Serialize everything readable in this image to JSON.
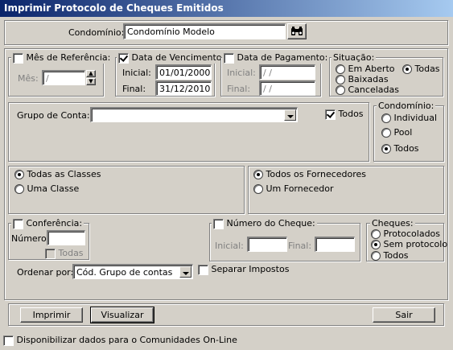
{
  "window": {
    "title": "Imprimir Protocolo de Cheques Emitidos"
  },
  "condominio": {
    "label": "Condomínio:",
    "value": "Condomínio Modelo"
  },
  "mes_referencia": {
    "label": "Mês de Referência:",
    "mes_label": "Mês:",
    "mes_value": "  /"
  },
  "data_vencimento": {
    "label": "Data de Vencimento:",
    "inicial_label": "Inicial:",
    "inicial_value": "01/01/2000",
    "final_label": "Final:",
    "final_value": "31/12/2010"
  },
  "data_pagamento": {
    "label": "Data de Pagamento:",
    "inicial_label": "Inicial:",
    "inicial_value": "  /  /",
    "final_label": "Final:",
    "final_value": "  /  /"
  },
  "situacao": {
    "label": "Situação:",
    "options": [
      "Em Aberto",
      "Todas",
      "Baixadas",
      "Canceladas"
    ],
    "selected": "Todas"
  },
  "grupo_conta": {
    "label": "Grupo de Conta:",
    "value": "",
    "todos_label": "Todos"
  },
  "condominio_opcoes": {
    "label": "Condomínio:",
    "options": [
      "Individual",
      "Pool",
      "Todos"
    ],
    "selected": "Todos"
  },
  "classes": {
    "options": [
      "Todas as Classes",
      "Uma Classe"
    ],
    "selected": "Todas as Classes"
  },
  "fornecedores": {
    "options": [
      "Todos os Fornecedores",
      "Um Fornecedor"
    ],
    "selected": "Todos os Fornecedores"
  },
  "conferencia": {
    "label": "Conferência:",
    "numero_label": "Número:",
    "numero_value": "",
    "todas_label": "Todas"
  },
  "numero_cheque": {
    "label": "Número do Cheque:",
    "inicial_label": "Inicial:",
    "inicial_value": "",
    "final_label": "Final:",
    "final_value": ""
  },
  "cheques": {
    "label": "Cheques:",
    "options": [
      "Protocolados",
      "Sem protocolo",
      "Todos"
    ],
    "selected": "Sem protocolo"
  },
  "ordenar": {
    "label": "Ordenar por:",
    "value": "Cód. Grupo de contas"
  },
  "separar_impostos": {
    "label": "Separar Impostos"
  },
  "buttons": {
    "imprimir": "Imprimir",
    "visualizar": "Visualizar",
    "sair": "Sair"
  },
  "disponibilizar": {
    "label": "Disponibilizar dados para o Comunidades On-Line"
  }
}
